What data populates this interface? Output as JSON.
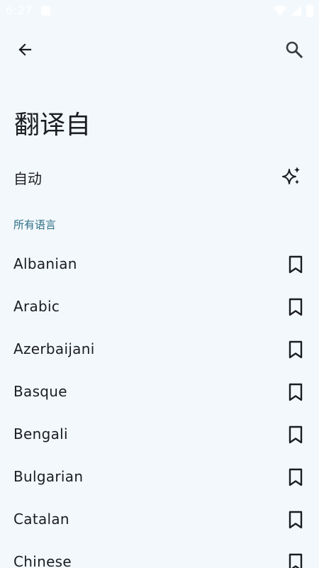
{
  "status_bar": {
    "time": "6:27"
  },
  "header": {
    "back_icon": "arrow-back-icon",
    "search_icon": "search-icon"
  },
  "page": {
    "title": "翻译自"
  },
  "auto_detect": {
    "label": "自动",
    "icon": "sparkle-icon"
  },
  "section": {
    "header": "所有语言"
  },
  "languages": [
    {
      "label": "Albanian"
    },
    {
      "label": "Arabic"
    },
    {
      "label": "Azerbaijani"
    },
    {
      "label": "Basque"
    },
    {
      "label": "Bengali"
    },
    {
      "label": "Bulgarian"
    },
    {
      "label": "Catalan"
    },
    {
      "label": "Chinese"
    }
  ],
  "colors": {
    "background": "#f3f8fc",
    "accent": "#2c6e85",
    "text": "#1b1d20"
  }
}
